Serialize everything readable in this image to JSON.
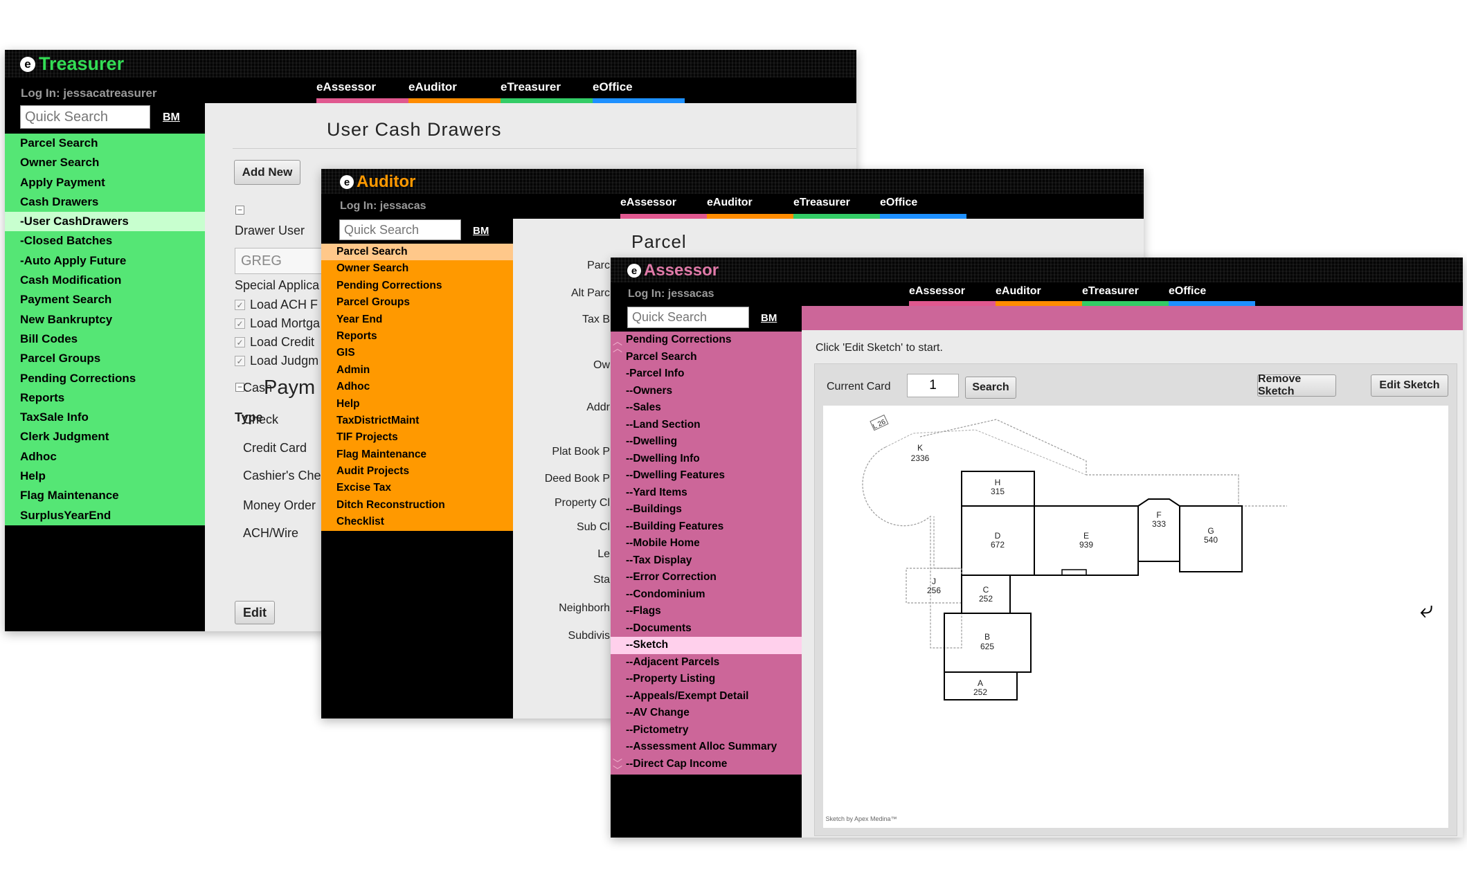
{
  "tabs": [
    "eAssessor",
    "eAuditor",
    "eTreasurer",
    "eOffice"
  ],
  "tab_colors": [
    "#e0588f",
    "#ff8c00",
    "#33cc66",
    "#1e90ff"
  ],
  "quick_search_placeholder": "Quick Search",
  "bm_label": "BM",
  "treasurer": {
    "title": "Treasurer",
    "accent": "#33dd55",
    "login": "Log In: jessacatreasurer",
    "menu": [
      "Parcel Search",
      "Owner Search",
      "Apply Payment",
      "Cash Drawers",
      "-User CashDrawers",
      "-Closed Batches",
      "-Auto Apply Future",
      "Cash Modification",
      "Payment Search",
      "New Bankruptcy",
      "Bill Codes",
      "Parcel Groups",
      "Pending Corrections",
      "Reports",
      "TaxSale Info",
      "Clerk Judgment",
      "Adhoc",
      "Help",
      "Flag Maintenance",
      "SurplusYearEnd"
    ],
    "page_title": "User Cash Drawers",
    "add_new": "Add New",
    "drawer_user_label": "Drawer User",
    "drawer_user_value": "GREG",
    "special_label": "Special Applica",
    "checkboxes": [
      "Load ACH F",
      "Load Mortga",
      "Load Credit",
      "Load Judgm"
    ],
    "payment_heading": "Paym",
    "type_label": "Type",
    "types": [
      "Cash",
      "Check",
      "Credit Card",
      "Cashier's Che",
      "Money Order",
      "ACH/Wire"
    ],
    "edit": "Edit"
  },
  "auditor": {
    "title": "Auditor",
    "accent": "#ff9900",
    "login": "Log In: jessacas",
    "menu": [
      "Parcel Search",
      "Owner Search",
      "Pending Corrections",
      "Parcel Groups",
      "Year End",
      "Reports",
      "GIS",
      "Admin",
      "Adhoc",
      "Help",
      "TaxDistrictMaint",
      "TIF Projects",
      "Flag Maintenance",
      "Audit Projects",
      "Excise Tax",
      "Ditch Reconstruction",
      "Checklist"
    ],
    "page_title": "Parcel",
    "fields": [
      "Parc",
      "Alt Parc",
      "Tax B",
      "Ow",
      "Addr",
      "Plat Book P",
      "Deed Book P",
      "Property Cl",
      "Sub Cl",
      "Le",
      "Sta",
      "Neighborh",
      "Subdivis"
    ]
  },
  "assessor": {
    "title": "Assessor",
    "accent": "#cc6699",
    "login": "Log In: jessacas",
    "menu": [
      "Pending Corrections",
      "Parcel Search",
      "-Parcel Info",
      "--Owners",
      "--Sales",
      "--Land Section",
      "--Dwelling",
      "--Dwelling Info",
      "--Dwelling Features",
      "--Yard Items",
      "--Buildings",
      "--Building Features",
      "--Mobile Home",
      "--Tax Display",
      "--Error Correction",
      "--Condominium",
      "--Flags",
      "--Documents",
      "--Sketch",
      "--Adjacent Parcels",
      "--Property Listing",
      "--Appeals/Exempt Detail",
      "--AV Change",
      "--Pictometry",
      "--Assessment Alloc Summary",
      "--Direct Cap Income"
    ],
    "instruction": "Click 'Edit Sketch' to start.",
    "current_card_label": "Current Card",
    "current_card_value": "1",
    "search_btn": "Search",
    "remove_sketch": "Remove Sketch",
    "edit_sketch": "Edit Sketch",
    "sketch_credit": "Sketch by Apex Medina™",
    "sketch_labels": {
      "K": "K",
      "K_area": "2336",
      "H": "H",
      "H_area": "315",
      "D": "D",
      "D_area": "672",
      "E": "E",
      "E_area": "939",
      "F": "F",
      "F_area": "333",
      "G": "G",
      "G_area": "540",
      "J": "J",
      "J_area": "256",
      "C": "C",
      "C_area": "252",
      "B": "B",
      "B_area": "625",
      "A": "A",
      "A_area": "252",
      "L": "L 26"
    }
  }
}
